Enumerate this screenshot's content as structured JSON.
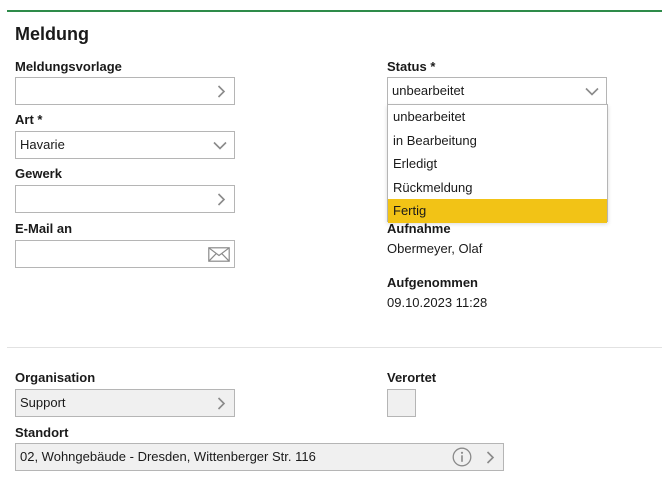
{
  "form": {
    "title": "Meldung",
    "meldungsvorlage": {
      "label": "Meldungsvorlage",
      "value": ""
    },
    "art": {
      "label": "Art *",
      "value": "Havarie"
    },
    "gewerk": {
      "label": "Gewerk",
      "value": ""
    },
    "email": {
      "label": "E-Mail an",
      "value": ""
    },
    "status": {
      "label": "Status *",
      "value": "unbearbeitet",
      "options": [
        "unbearbeitet",
        "in Bearbeitung",
        "Erledigt",
        "Rückmeldung",
        "Fertig"
      ],
      "highlighted": "Fertig"
    },
    "aufnahme": {
      "label": "Aufnahme",
      "value": "Obermeyer, Olaf"
    },
    "aufgenommen": {
      "label": "Aufgenommen",
      "value": "09.10.2023 11:28"
    },
    "organisation": {
      "label": "Organisation",
      "value": "Support"
    },
    "verortet": {
      "label": "Verortet",
      "checked": false
    },
    "standort": {
      "label": "Standort",
      "value": "02, Wohngebäude - Dresden, Wittenberger Str. 116"
    }
  },
  "colors": {
    "accent": "#2e8b4a",
    "highlight": "#f2c316",
    "icon": "#8a8a8a"
  }
}
